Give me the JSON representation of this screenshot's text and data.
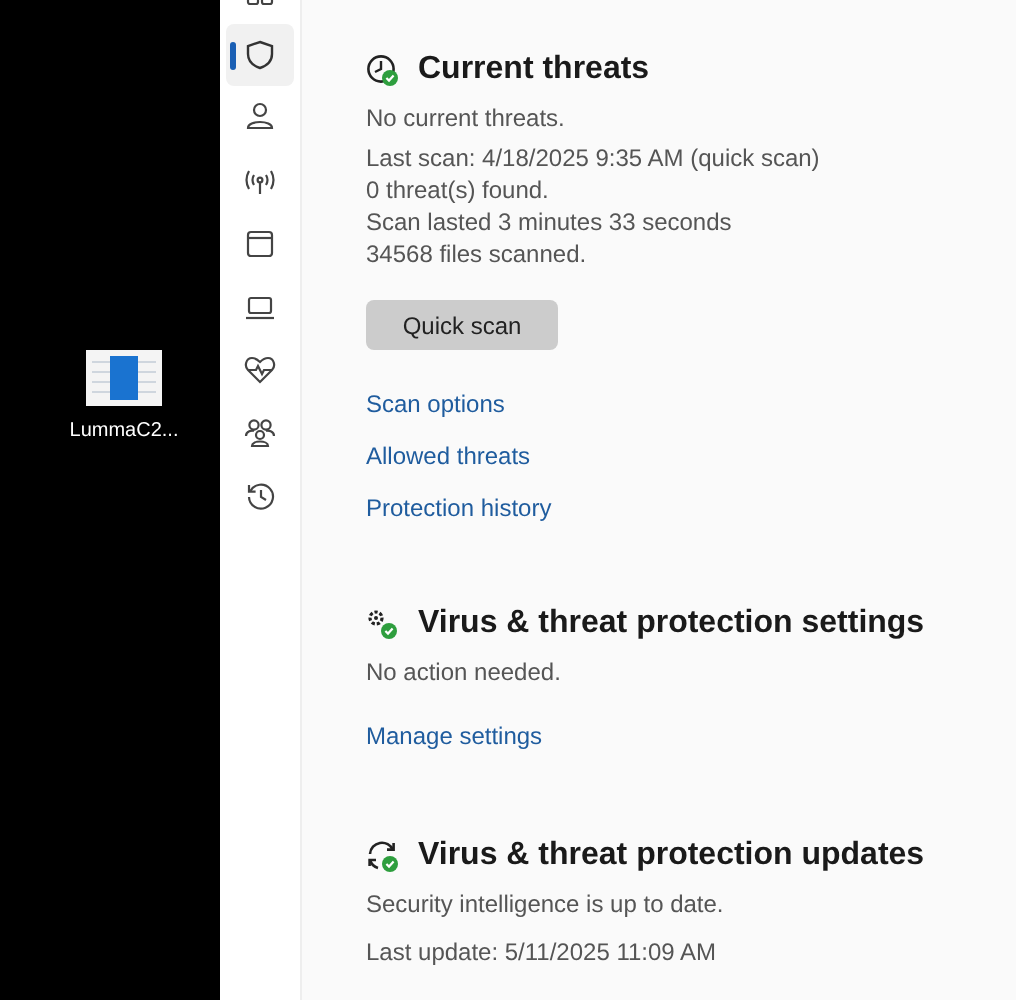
{
  "desktop": {
    "icons": [
      {
        "label": "LummaC2..."
      }
    ]
  },
  "nav": {
    "items": [
      {
        "kind": "apps",
        "selected": false
      },
      {
        "kind": "shield",
        "selected": true
      },
      {
        "kind": "person",
        "selected": false
      },
      {
        "kind": "wireless",
        "selected": false
      },
      {
        "kind": "browser",
        "selected": false
      },
      {
        "kind": "laptop",
        "selected": false
      },
      {
        "kind": "health",
        "selected": false
      },
      {
        "kind": "family",
        "selected": false
      },
      {
        "kind": "history",
        "selected": false
      }
    ]
  },
  "sections": [
    {
      "kind": "threats",
      "title": "Current threats",
      "status": "No current threats.",
      "details": [
        "Last scan: 4/18/2025 9:35 AM (quick scan)",
        "0 threat(s) found.",
        "Scan lasted 3 minutes 33 seconds",
        "34568 files scanned."
      ],
      "button": "Quick scan",
      "links": [
        "Scan options",
        "Allowed threats",
        "Protection history"
      ]
    },
    {
      "kind": "settings",
      "title": "Virus & threat protection settings",
      "status": "No action needed.",
      "links": [
        "Manage settings"
      ]
    },
    {
      "kind": "updates",
      "title": "Virus & threat protection updates",
      "status": "Security intelligence is up to date.",
      "details": [
        "Last update: 5/11/2025 11:09 AM"
      ]
    }
  ]
}
